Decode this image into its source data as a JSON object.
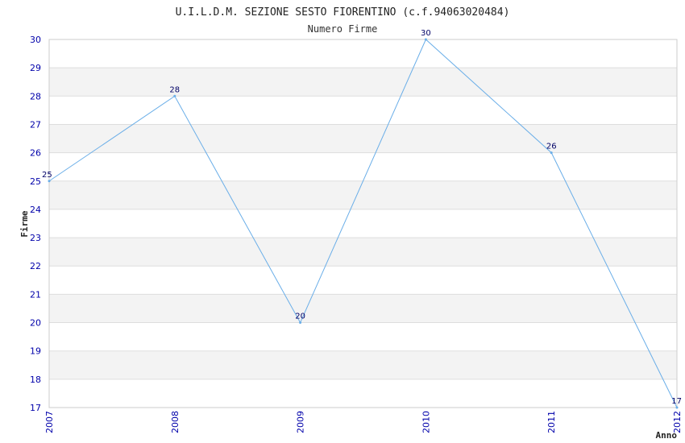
{
  "chart_data": {
    "type": "line",
    "title": "U.I.L.D.M. SEZIONE SESTO FIORENTINO (c.f.94063020484)",
    "subtitle": "Numero Firme",
    "xlabel": "Anno",
    "ylabel": "Firme",
    "categories": [
      "2007",
      "2008",
      "2009",
      "2010",
      "2011",
      "2012"
    ],
    "series": [
      {
        "values": [
          25,
          28,
          20,
          30,
          26,
          17
        ]
      }
    ],
    "ylim": [
      17,
      30
    ],
    "yticks": [
      17,
      18,
      19,
      20,
      21,
      22,
      23,
      24,
      25,
      26,
      27,
      28,
      29,
      30
    ],
    "grid": true,
    "line_color": "#6aaee8",
    "band_color": "#f3f3f3",
    "tick_color": "#0000aa"
  }
}
